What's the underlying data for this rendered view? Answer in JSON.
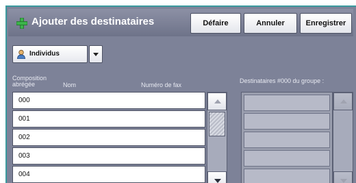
{
  "header": {
    "title": "Ajouter des destinataires",
    "title_icon": "add-recipient-icon",
    "buttons": {
      "undo": "Défaire",
      "cancel": "Annuler",
      "save": "Enregistrer"
    }
  },
  "filter": {
    "selected": "Individus",
    "icon": "person-icon"
  },
  "columns": {
    "speed_dial": "Composition\nabrégée",
    "name": "Nom",
    "fax": "Numéro de fax"
  },
  "entries": [
    {
      "code": "000"
    },
    {
      "code": "001"
    },
    {
      "code": "002"
    },
    {
      "code": "003"
    },
    {
      "code": "004"
    }
  ],
  "group": {
    "header": "Destinataires #000 du groupe :"
  },
  "colors": {
    "panel": "#7d8298",
    "accent": "#3a9a9e",
    "icon_green": "#3cb44a"
  }
}
